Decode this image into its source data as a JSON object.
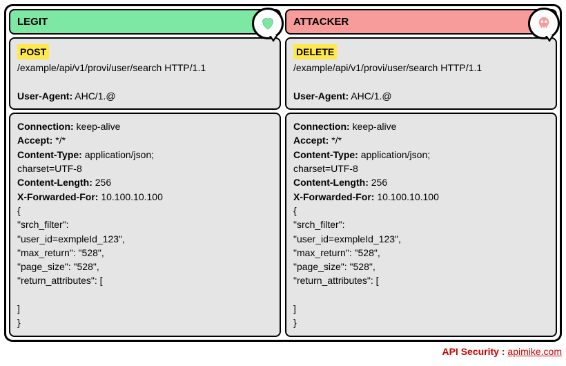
{
  "panels": [
    {
      "id": "legit",
      "title": "LEGIT",
      "icon": "heart-icon",
      "method": "POST",
      "url": "/example/api/v1/provi/user/search HTTP/1.1",
      "userAgentLabel": "User-Agent:",
      "userAgentValue": "AHC/1.@",
      "headers": [
        {
          "k": "Connection:",
          "v": "keep-alive"
        },
        {
          "k": "Accept:",
          "v": "*/*"
        },
        {
          "k": "Content-Type:",
          "v": "application/json;"
        },
        {
          "k": "",
          "v": "charset=UTF-8"
        },
        {
          "k": "Content-Length:",
          "v": "256"
        },
        {
          "k": "X-Forwarded-For:",
          "v": "10.100.10.100"
        }
      ],
      "body": [
        "{",
        "\"srch_filter\":",
        "\"user_id=exmpleId_123\",",
        "\"max_return\": \"528\",",
        "\"page_size\": \"528\",",
        "\"return_attributes\": [",
        "",
        "]",
        "}"
      ]
    },
    {
      "id": "attacker",
      "title": "ATTACKER",
      "icon": "skull-icon",
      "method": "DELETE",
      "url": "/example/api/v1/provi/user/search HTTP/1.1",
      "userAgentLabel": "User-Agent:",
      "userAgentValue": "AHC/1.@",
      "headers": [
        {
          "k": "Connection:",
          "v": "keep-alive"
        },
        {
          "k": "Accept:",
          "v": "*/*"
        },
        {
          "k": "Content-Type:",
          "v": "application/json;"
        },
        {
          "k": "",
          "v": "charset=UTF-8"
        },
        {
          "k": "Content-Length:",
          "v": "256"
        },
        {
          "k": "X-Forwarded-For:",
          "v": "10.100.10.100"
        }
      ],
      "body": [
        "{",
        "\"srch_filter\":",
        "\"user_id=exmpleId_123\",",
        "\"max_return\": \"528\",",
        "\"page_size\": \"528\",",
        "\"return_attributes\": [",
        "",
        "]",
        "}"
      ]
    }
  ],
  "footer": {
    "label": "API Security :",
    "site": "apimike.com"
  }
}
